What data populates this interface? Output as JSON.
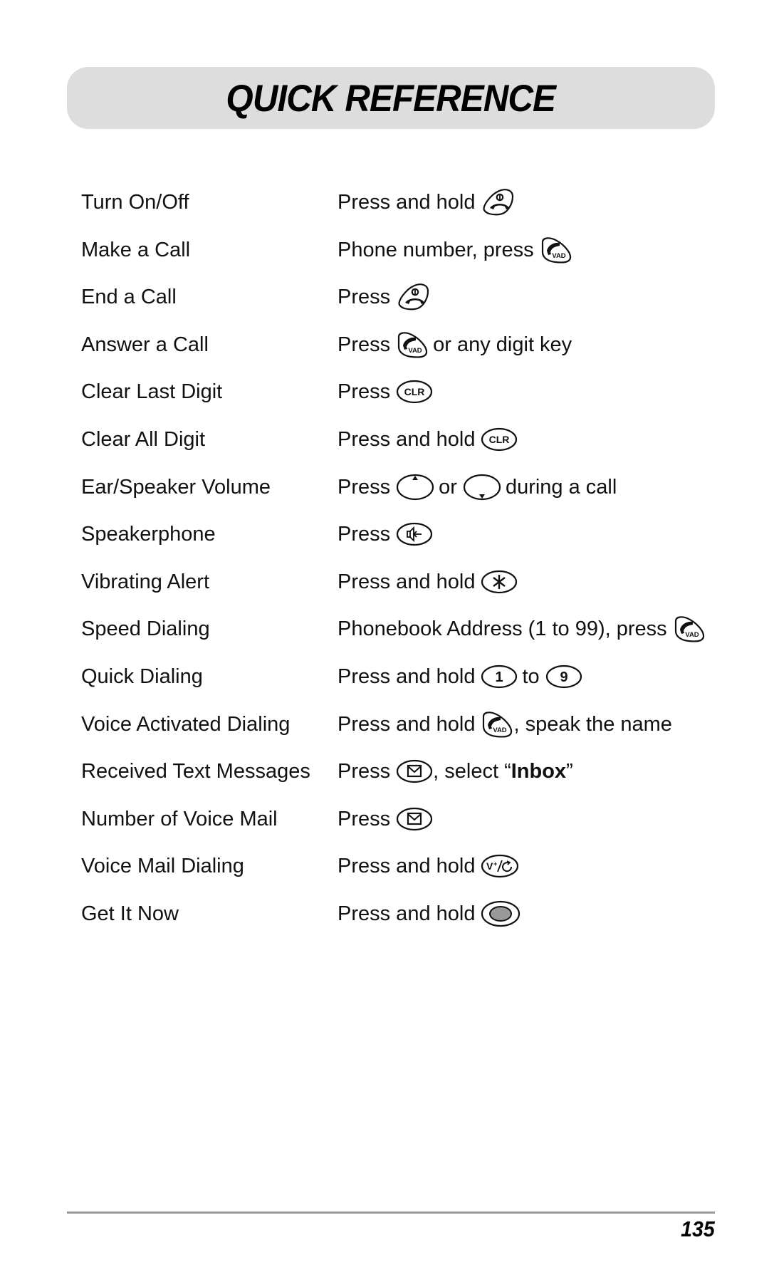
{
  "header": {
    "title": "QUICK REFERENCE"
  },
  "rows": [
    {
      "label": "Turn On/Off",
      "parts": [
        {
          "t": "text",
          "v": "Press and hold"
        },
        {
          "t": "key",
          "icon": "end-power-key-icon"
        }
      ]
    },
    {
      "label": "Make a Call",
      "parts": [
        {
          "t": "text",
          "v": "Phone number, press"
        },
        {
          "t": "key",
          "icon": "send-vad-key-icon"
        }
      ]
    },
    {
      "label": "End a Call",
      "parts": [
        {
          "t": "text",
          "v": "Press"
        },
        {
          "t": "key",
          "icon": "end-power-key-icon"
        }
      ]
    },
    {
      "label": "Answer a Call",
      "parts": [
        {
          "t": "text",
          "v": "Press"
        },
        {
          "t": "key",
          "icon": "send-vad-key-icon"
        },
        {
          "t": "text",
          "v": "or any digit key"
        }
      ]
    },
    {
      "label": "Clear Last Digit",
      "parts": [
        {
          "t": "text",
          "v": "Press"
        },
        {
          "t": "key",
          "icon": "clr-key-icon",
          "v": "CLR"
        }
      ]
    },
    {
      "label": "Clear All Digit",
      "parts": [
        {
          "t": "text",
          "v": "Press and hold"
        },
        {
          "t": "key",
          "icon": "clr-key-icon",
          "v": "CLR"
        }
      ]
    },
    {
      "label": "Ear/Speaker Volume",
      "parts": [
        {
          "t": "text",
          "v": "Press"
        },
        {
          "t": "key",
          "icon": "volume-up-key-icon"
        },
        {
          "t": "text",
          "v": "or"
        },
        {
          "t": "key",
          "icon": "volume-down-key-icon"
        },
        {
          "t": "text",
          "v": "during a call"
        }
      ]
    },
    {
      "label": "Speakerphone",
      "parts": [
        {
          "t": "text",
          "v": "Press"
        },
        {
          "t": "key",
          "icon": "speakerphone-key-icon"
        }
      ]
    },
    {
      "label": "Vibrating Alert",
      "parts": [
        {
          "t": "text",
          "v": "Press and hold"
        },
        {
          "t": "key",
          "icon": "star-key-icon",
          "v": "*"
        }
      ]
    },
    {
      "label": "Speed Dialing",
      "parts": [
        {
          "t": "text",
          "v": "Phonebook Address (1 to 99), press"
        },
        {
          "t": "key",
          "icon": "send-vad-key-icon"
        }
      ]
    },
    {
      "label": "Quick Dialing",
      "parts": [
        {
          "t": "text",
          "v": "Press and hold"
        },
        {
          "t": "key",
          "icon": "digit-key-icon",
          "v": "1"
        },
        {
          "t": "text",
          "v": "to"
        },
        {
          "t": "key",
          "icon": "digit-key-icon",
          "v": "9"
        }
      ]
    },
    {
      "label": "Voice Activated Dialing",
      "parts": [
        {
          "t": "text",
          "v": "Press and hold"
        },
        {
          "t": "key",
          "icon": "send-vad-key-icon"
        },
        {
          "t": "text",
          "v": ", speak the name",
          "tight": true
        }
      ]
    },
    {
      "label": "Received Text Messages",
      "parts": [
        {
          "t": "text",
          "v": "Press"
        },
        {
          "t": "key",
          "icon": "message-key-icon"
        },
        {
          "t": "text",
          "v": ", select “",
          "tight": true
        },
        {
          "t": "bold",
          "v": "Inbox"
        },
        {
          "t": "text",
          "v": "”",
          "tight": true
        }
      ]
    },
    {
      "label": "Number of Voice Mail",
      "parts": [
        {
          "t": "text",
          "v": "Press"
        },
        {
          "t": "key",
          "icon": "message-key-icon"
        }
      ]
    },
    {
      "label": "Voice Mail Dialing",
      "parts": [
        {
          "t": "text",
          "v": "Press and hold"
        },
        {
          "t": "key",
          "icon": "voicemail-redial-key-icon",
          "v": "V+/"
        }
      ]
    },
    {
      "label": "Get It Now",
      "parts": [
        {
          "t": "text",
          "v": "Press and hold"
        },
        {
          "t": "key",
          "icon": "get-it-now-key-icon"
        }
      ]
    }
  ],
  "footer": {
    "page_number": "135"
  },
  "colors": {
    "title_box": "#dddddd",
    "rule": "#9a9a9a",
    "text": "#111111",
    "get_it_now_fill": "#999999"
  }
}
